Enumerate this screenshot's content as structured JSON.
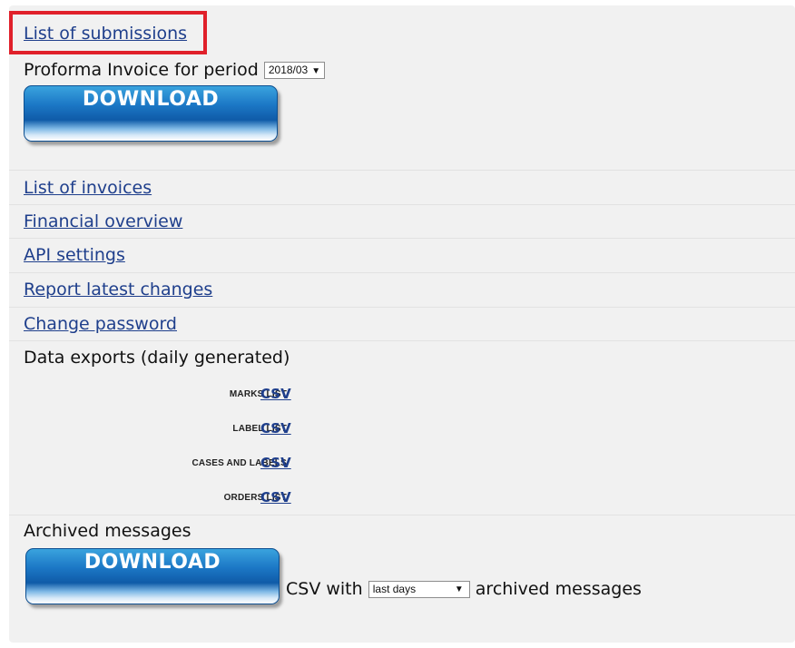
{
  "links": {
    "submissions": "List of submissions",
    "invoices": "List of invoices",
    "financial": "Financial overview",
    "api": "API settings",
    "report": "Report latest changes",
    "password": "Change password"
  },
  "proforma": {
    "label": "Proforma Invoice for period",
    "period": "2018/03",
    "download": "DOWNLOAD"
  },
  "exports": {
    "title": "Data exports (daily generated)",
    "items": [
      {
        "label": "MARKS LIST",
        "link": "CSV"
      },
      {
        "label": "LABEL LIST",
        "link": "CSV"
      },
      {
        "label": "CASES AND LABELS",
        "link": "CSV"
      },
      {
        "label": "ORDERS LIST",
        "link": "CSV"
      }
    ]
  },
  "archived": {
    "title": "Archived messages",
    "download": "DOWNLOAD",
    "prefix": "CSV with",
    "range": "last days",
    "suffix": "archived messages"
  },
  "colors": {
    "link": "#1f3f8c",
    "highlight": "#e0202a",
    "button": "#1c78c6"
  }
}
